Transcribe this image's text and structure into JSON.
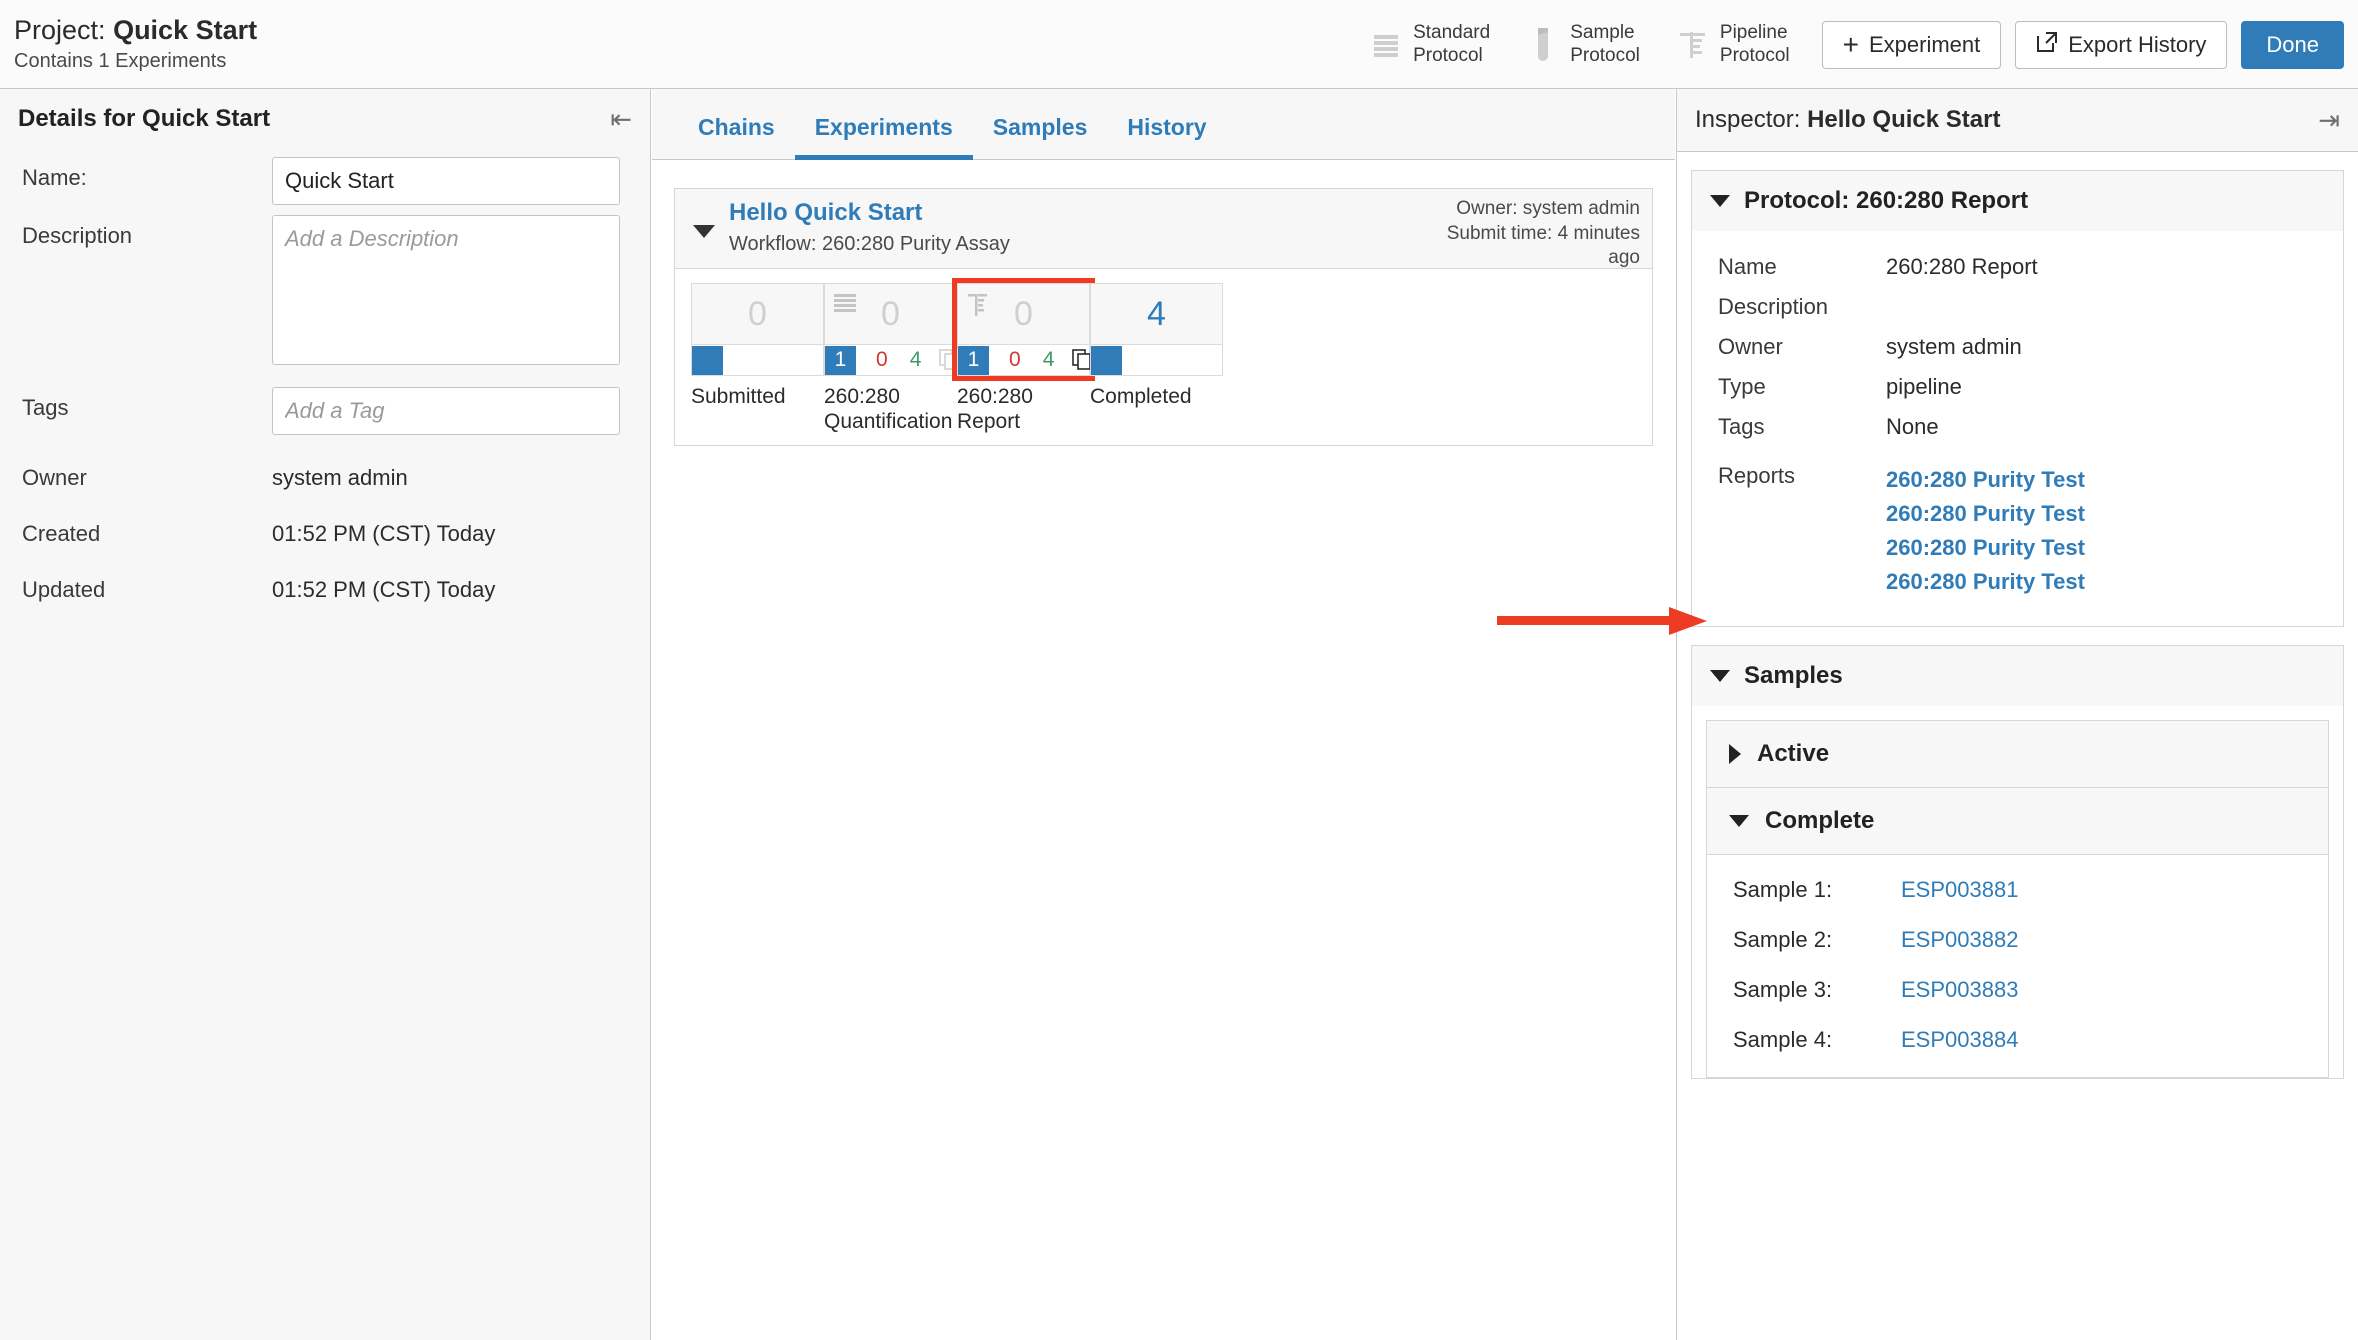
{
  "header": {
    "project_prefix": "Project:",
    "project_name": "Quick Start",
    "subtitle": "Contains 1 Experiments",
    "protocols": [
      {
        "label_line1": "Standard",
        "label_line2": "Protocol",
        "icon": "stacked-lines-icon"
      },
      {
        "label_line1": "Sample",
        "label_line2": "Protocol",
        "icon": "test-tube-icon"
      },
      {
        "label_line1": "Pipeline",
        "label_line2": "Protocol",
        "icon": "pipeline-tree-icon"
      }
    ],
    "experiment_button": "Experiment",
    "export_button": "Export History",
    "done_button": "Done"
  },
  "details": {
    "title": "Details for Quick Start",
    "name_label": "Name:",
    "name_value": "Quick Start",
    "description_label": "Description",
    "description_placeholder": "Add a Description",
    "description_value": "",
    "tags_label": "Tags",
    "tags_placeholder": "Add a Tag",
    "tags_value": "",
    "owner_label": "Owner",
    "owner_value": "system admin",
    "created_label": "Created",
    "created_value": "01:52 PM (CST) Today",
    "updated_label": "Updated",
    "updated_value": "01:52 PM (CST) Today"
  },
  "tabs": [
    {
      "label": "Chains",
      "active": false
    },
    {
      "label": "Experiments",
      "active": true
    },
    {
      "label": "Samples",
      "active": false
    },
    {
      "label": "History",
      "active": false
    }
  ],
  "experiment": {
    "name": "Hello Quick Start",
    "workflow": "Workflow: 260:280 Purity Assay",
    "owner": "Owner: system admin",
    "submit_time": "Submit time: 4 minutes ago",
    "stages": [
      {
        "label": "Submitted",
        "count": "0",
        "count_active": false,
        "icon": "",
        "highlighted": false,
        "has_counts": false,
        "badge": "",
        "errors": "",
        "passed": "",
        "has_copy": false
      },
      {
        "label": "260:280 Quantification",
        "count": "0",
        "count_active": false,
        "icon": "stacked-lines-icon",
        "highlighted": false,
        "has_counts": true,
        "badge": "1",
        "errors": "0",
        "passed": "4",
        "has_copy": true
      },
      {
        "label": "260:280 Report",
        "count": "0",
        "count_active": false,
        "icon": "pipeline-tree-icon",
        "highlighted": true,
        "has_counts": true,
        "badge": "1",
        "errors": "0",
        "passed": "4",
        "has_copy": true
      },
      {
        "label": "Completed",
        "count": "4",
        "count_active": true,
        "icon": "",
        "highlighted": false,
        "has_counts": false,
        "badge": "",
        "errors": "",
        "passed": "",
        "has_copy": false
      }
    ]
  },
  "inspector": {
    "prefix": "Inspector:",
    "title": "Hello Quick Start",
    "protocol_section_title": "Protocol: 260:280 Report",
    "fields": [
      {
        "key": "Name",
        "value": "260:280 Report"
      },
      {
        "key": "Description",
        "value": ""
      },
      {
        "key": "Owner",
        "value": "system admin"
      },
      {
        "key": "Type",
        "value": "pipeline"
      },
      {
        "key": "Tags",
        "value": "None"
      }
    ],
    "reports_label": "Reports",
    "reports": [
      "260:280 Purity Test",
      "260:280 Purity Test",
      "260:280 Purity Test",
      "260:280 Purity Test"
    ],
    "samples_section_title": "Samples",
    "active_group_title": "Active",
    "complete_group_title": "Complete",
    "samples": [
      {
        "key": "Sample 1:",
        "value": "ESP003881"
      },
      {
        "key": "Sample 2:",
        "value": "ESP003882"
      },
      {
        "key": "Sample 3:",
        "value": "ESP003883"
      },
      {
        "key": "Sample 4:",
        "value": "ESP003884"
      }
    ]
  },
  "colors": {
    "accent_blue": "#2f7cb8",
    "error_red": "#cf3a2e",
    "pass_green": "#3f9a63",
    "annotation_red": "#ee3b24"
  }
}
